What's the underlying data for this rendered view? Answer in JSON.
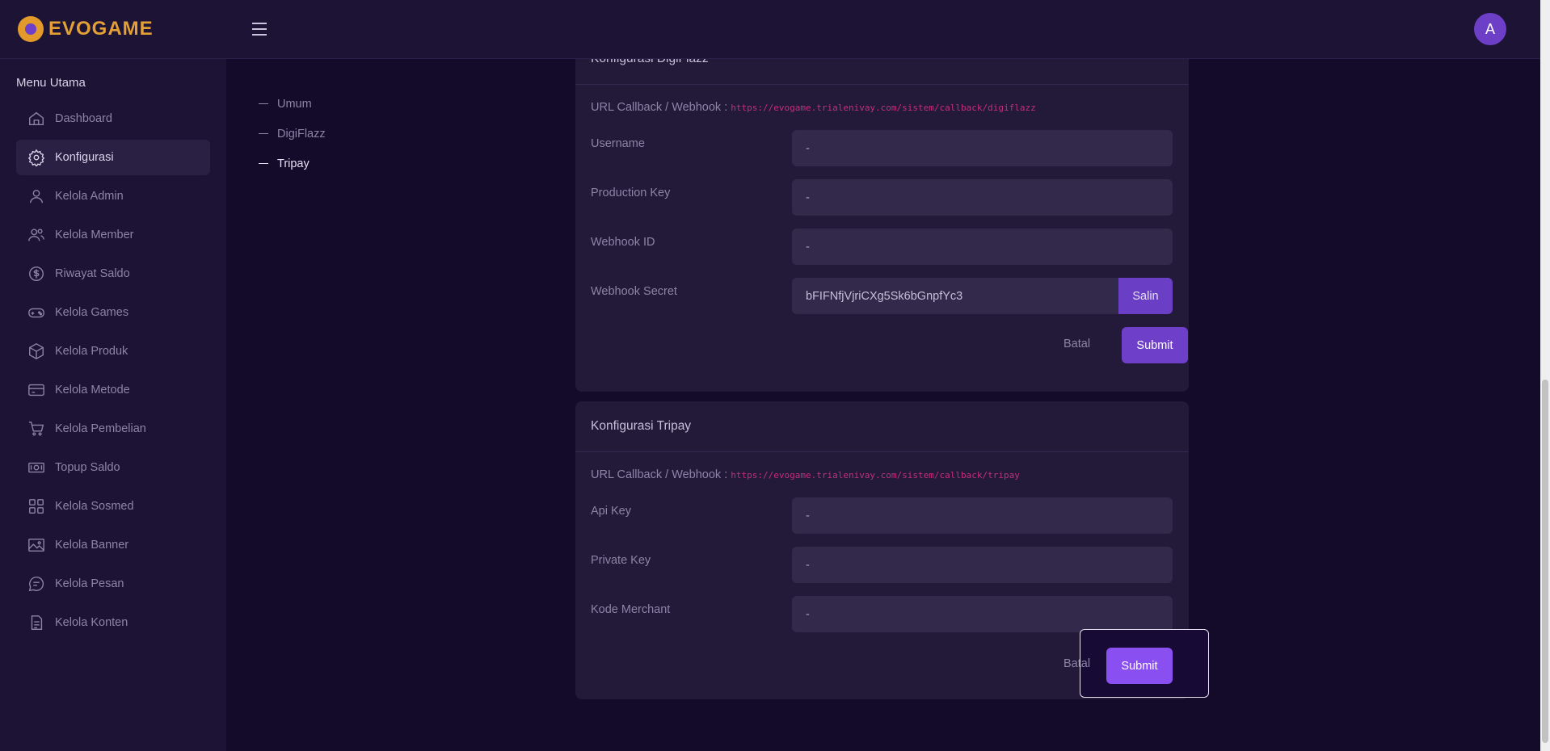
{
  "header": {
    "brand": "EVOGAME",
    "avatar_initial": "A"
  },
  "sidebar": {
    "title": "Menu Utama",
    "items": [
      {
        "label": "Dashboard",
        "icon": "home-icon",
        "active": false
      },
      {
        "label": "Konfigurasi",
        "icon": "gear-icon",
        "active": true
      },
      {
        "label": "Kelola Admin",
        "icon": "user-icon",
        "active": false
      },
      {
        "label": "Kelola Member",
        "icon": "users-icon",
        "active": false
      },
      {
        "label": "Riwayat Saldo",
        "icon": "dollar-circle-icon",
        "active": false
      },
      {
        "label": "Kelola Games",
        "icon": "gamepad-icon",
        "active": false
      },
      {
        "label": "Kelola Produk",
        "icon": "box-icon",
        "active": false
      },
      {
        "label": "Kelola Metode",
        "icon": "card-icon",
        "active": false
      },
      {
        "label": "Kelola Pembelian",
        "icon": "cart-icon",
        "active": false
      },
      {
        "label": "Topup Saldo",
        "icon": "money-icon",
        "active": false
      },
      {
        "label": "Kelola Sosmed",
        "icon": "grid-icon",
        "active": false
      },
      {
        "label": "Kelola Banner",
        "icon": "image-icon",
        "active": false
      },
      {
        "label": "Kelola Pesan",
        "icon": "chat-icon",
        "active": false
      },
      {
        "label": "Kelola Konten",
        "icon": "file-icon",
        "active": false
      }
    ]
  },
  "section_nav": [
    {
      "label": "Umum",
      "active": false
    },
    {
      "label": "DigiFlazz",
      "active": false
    },
    {
      "label": "Tripay",
      "active": true
    }
  ],
  "digiflazz": {
    "title": "Konfigurasi DigiFlazz",
    "callback_label": "URL Callback / Webhook :",
    "callback_url": "https://evogame.trialenivay.com/sistem/callback/digiflazz",
    "fields": [
      {
        "label": "Username",
        "value": "-"
      },
      {
        "label": "Production Key",
        "value": "-"
      },
      {
        "label": "Webhook ID",
        "value": "-"
      }
    ],
    "secret_label": "Webhook Secret",
    "secret_value": "bFIFNfjVjriCXg5Sk6bGnpfYc3",
    "copy_label": "Salin",
    "cancel_label": "Batal",
    "submit_label": "Submit"
  },
  "tripay": {
    "title": "Konfigurasi Tripay",
    "callback_label": "URL Callback / Webhook :",
    "callback_url": "https://evogame.trialenivay.com/sistem/callback/tripay",
    "fields": [
      {
        "label": "Api Key",
        "value": "-"
      },
      {
        "label": "Private Key",
        "value": "-"
      },
      {
        "label": "Kode Merchant",
        "value": "-"
      }
    ],
    "cancel_label": "Batal",
    "submit_label": "Submit"
  }
}
